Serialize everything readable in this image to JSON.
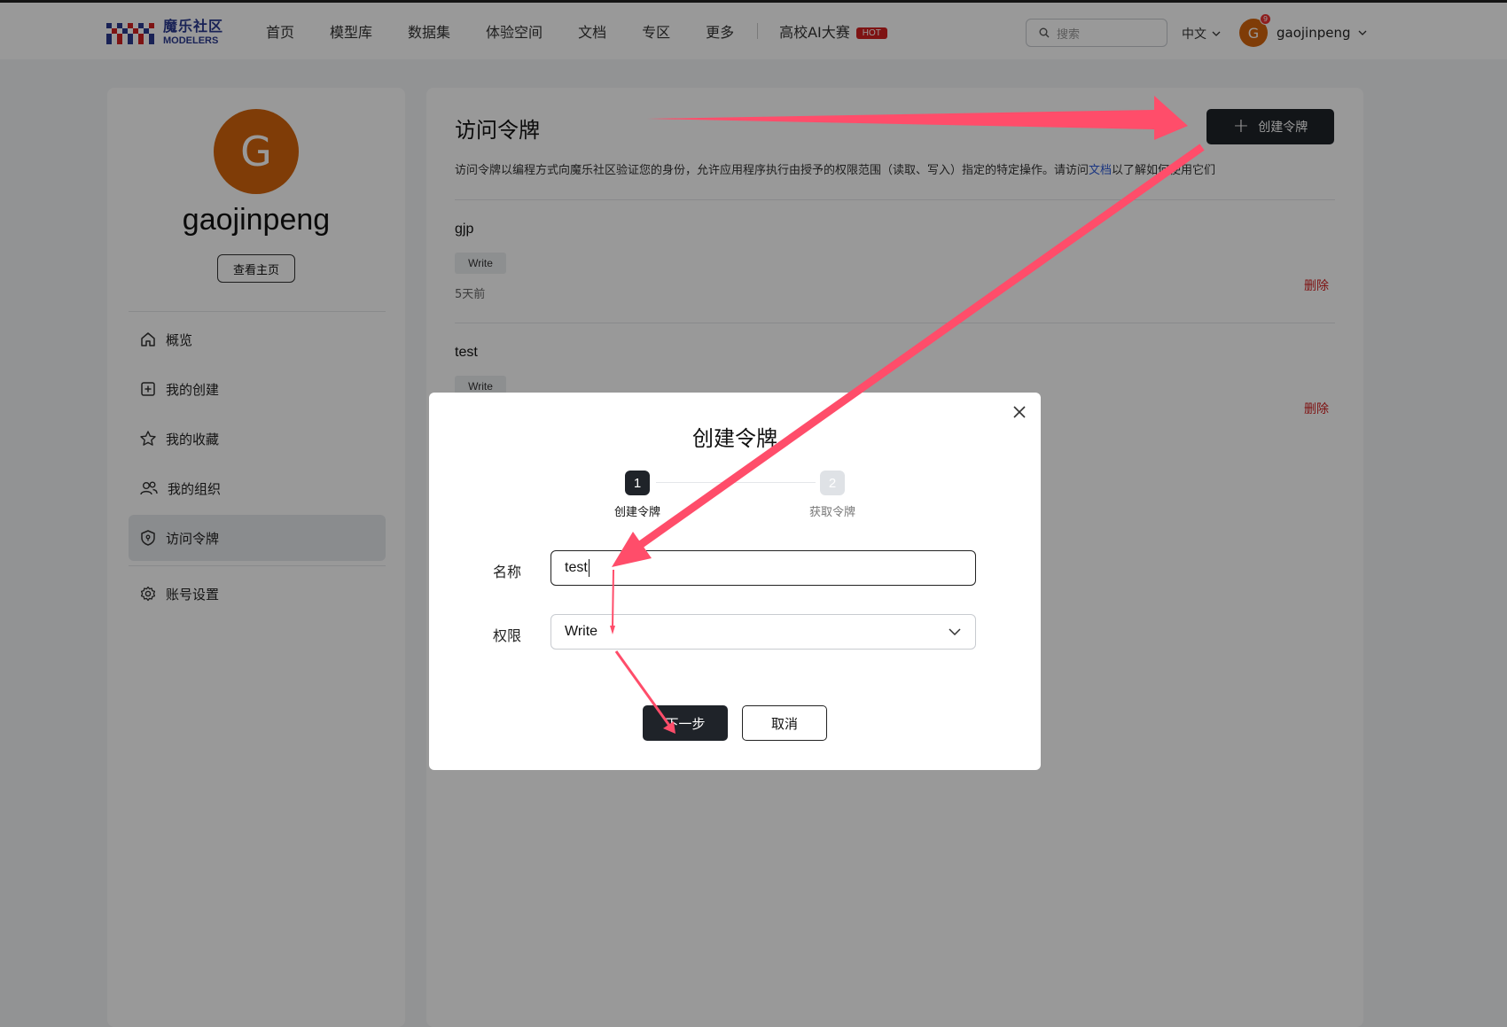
{
  "header": {
    "logo_cn": "魔乐社区",
    "logo_en": "MODELERS",
    "nav": [
      "首页",
      "模型库",
      "数据集",
      "体验空间",
      "文档",
      "专区",
      "更多"
    ],
    "contest": "高校AI大赛",
    "contest_badge": "HOT",
    "search_placeholder": "搜索",
    "language": "中文",
    "avatar_letter": "G",
    "notification_count": "9",
    "username": "gaojinpeng"
  },
  "sidebar": {
    "avatar_letter": "G",
    "username": "gaojinpeng",
    "home_button": "查看主页",
    "menu": [
      "概览",
      "我的创建",
      "我的收藏",
      "我的组织",
      "访问令牌",
      "账号设置"
    ],
    "active": "访问令牌"
  },
  "main": {
    "title": "访问令牌",
    "create_button": "创建令牌",
    "desc_before": "访问令牌以编程方式向魔乐社区验证您的身份，允许应用程序执行由授予的权限范围（读取、写入）指定的特定操作。请访问",
    "desc_link": "文档",
    "desc_after": "以了解如何使用它们",
    "tokens": [
      {
        "name": "gjp",
        "permission": "Write",
        "time": "5天前",
        "delete": "删除"
      },
      {
        "name": "test",
        "permission": "Write",
        "time": "",
        "delete": "删除"
      }
    ]
  },
  "modal": {
    "title": "创建令牌",
    "steps": [
      {
        "number": "1",
        "label": "创建令牌",
        "active": true
      },
      {
        "number": "2",
        "label": "获取令牌",
        "active": false
      }
    ],
    "name_label": "名称",
    "name_value": "test",
    "permission_label": "权限",
    "permission_value": "Write",
    "next_button": "下一步",
    "cancel_button": "取消"
  },
  "colors": {
    "brand_dark": "#1f2329",
    "avatar": "#d4640c",
    "danger": "#d32020",
    "link": "#2e5bd8",
    "annotation_arrow": "#ff4d6a"
  }
}
